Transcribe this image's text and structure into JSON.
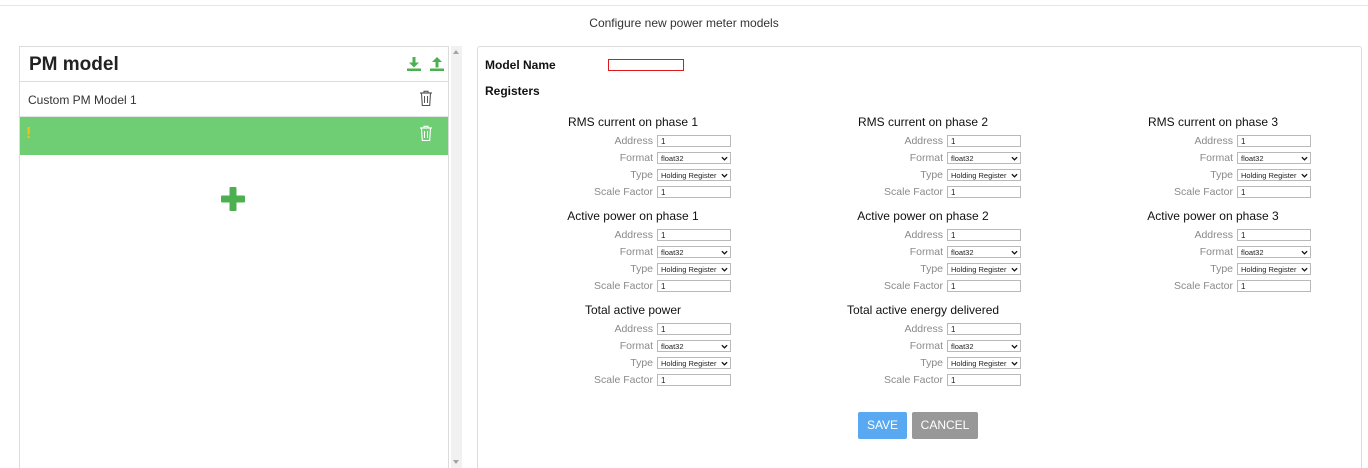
{
  "page": {
    "title": "Configure new power meter models"
  },
  "left_panel": {
    "title": "PM model",
    "icons": [
      "download-icon",
      "upload-icon"
    ],
    "models": [
      {
        "name": "Custom PM Model 1",
        "selected": false,
        "warning": ""
      },
      {
        "name": "",
        "selected": true,
        "warning": "!"
      }
    ]
  },
  "editor": {
    "model_name_label": "Model Name",
    "model_name_value": "",
    "registers_label": "Registers",
    "field_labels": {
      "address": "Address",
      "format": "Format",
      "type": "Type",
      "scale": "Scale Factor"
    },
    "registers": [
      {
        "title": "RMS current on phase 1",
        "address": "1",
        "format": "float32",
        "type": "Holding Register",
        "scale": "1"
      },
      {
        "title": "RMS current on phase 2",
        "address": "1",
        "format": "float32",
        "type": "Holding Register",
        "scale": "1"
      },
      {
        "title": "RMS current on phase 3",
        "address": "1",
        "format": "float32",
        "type": "Holding Register",
        "scale": "1"
      },
      {
        "title": "Active power on phase 1",
        "address": "1",
        "format": "float32",
        "type": "Holding Register",
        "scale": "1"
      },
      {
        "title": "Active power on phase 2",
        "address": "1",
        "format": "float32",
        "type": "Holding Register",
        "scale": "1"
      },
      {
        "title": "Active power on phase 3",
        "address": "1",
        "format": "float32",
        "type": "Holding Register",
        "scale": "1"
      },
      {
        "title": "Total active power",
        "address": "1",
        "format": "float32",
        "type": "Holding Register",
        "scale": "1"
      },
      {
        "title": "Total active energy delivered",
        "address": "1",
        "format": "float32",
        "type": "Holding Register",
        "scale": "1"
      }
    ],
    "save_label": "SAVE",
    "cancel_label": "CANCEL"
  },
  "colors": {
    "selected_row": "#6fce74",
    "icon_green": "#4cb050",
    "save": "#59a8f2",
    "cancel": "#989898",
    "error_border": "#e0191b",
    "warning": "#f3c212"
  }
}
